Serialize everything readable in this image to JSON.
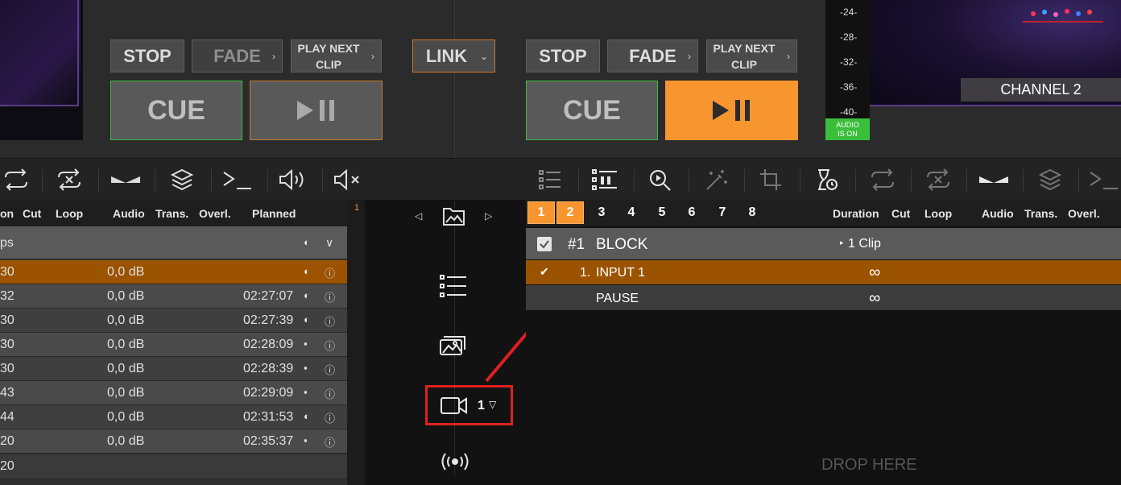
{
  "meter": {
    "ticks": [
      "-24-",
      "-28-",
      "-32-",
      "-36-",
      "-40-"
    ],
    "audio_status": "AUDIO IS ON"
  },
  "preview": {
    "channel_label": "CHANNEL 2"
  },
  "left_deck": {
    "stop": "STOP",
    "fade": "FADE",
    "play_next": "PLAY NEXT CLIP",
    "cue": "CUE"
  },
  "link": {
    "label": "LINK"
  },
  "right_deck": {
    "stop": "STOP",
    "fade": "FADE",
    "play_next": "PLAY NEXT CLIP",
    "cue": "CUE"
  },
  "colors": {
    "accent": "#f7962f",
    "selected_row": "#9b5300",
    "green": "#3bbf3b"
  },
  "left_table": {
    "headers": [
      "on",
      "Cut",
      "Loop",
      "Audio",
      "Trans.",
      "Overl.",
      "Planned"
    ],
    "group_label": "ps",
    "rows": [
      {
        "dur": "30",
        "audio": "0,0 dB",
        "planned": "",
        "overlay": "half"
      },
      {
        "dur": "32",
        "audio": "0,0 dB",
        "planned": "02:27:07",
        "overlay": "half"
      },
      {
        "dur": "30",
        "audio": "0,0 dB",
        "planned": "02:27:39",
        "overlay": "half"
      },
      {
        "dur": "30",
        "audio": "0,0 dB",
        "planned": "02:28:09",
        "overlay": "dot"
      },
      {
        "dur": "30",
        "audio": "0,0 dB",
        "planned": "02:28:39",
        "overlay": "dot"
      },
      {
        "dur": "43",
        "audio": "0,0 dB",
        "planned": "02:29:09",
        "overlay": "dot"
      },
      {
        "dur": "44",
        "audio": "0,0 dB",
        "planned": "02:31:53",
        "overlay": "half"
      },
      {
        "dur": "20",
        "audio": "0,0 dB",
        "planned": "02:35:37",
        "overlay": "dot"
      }
    ],
    "last_row": "20"
  },
  "line_number": "1",
  "sidebar": {
    "camera_count": "1"
  },
  "right_table": {
    "tabs": [
      "1",
      "2",
      "3",
      "4",
      "5",
      "6",
      "7",
      "8"
    ],
    "headers": [
      "Duration",
      "Cut",
      "Loop",
      "Audio",
      "Trans.",
      "Overl."
    ],
    "block": {
      "number": "#1",
      "name": "BLOCK",
      "clips": "1 Clip"
    },
    "items": [
      {
        "index": "1.",
        "name": "INPUT 1",
        "duration": "∞"
      },
      {
        "index": "",
        "name": "PAUSE",
        "duration": "∞"
      }
    ],
    "drop_hint": "DROP HERE"
  }
}
